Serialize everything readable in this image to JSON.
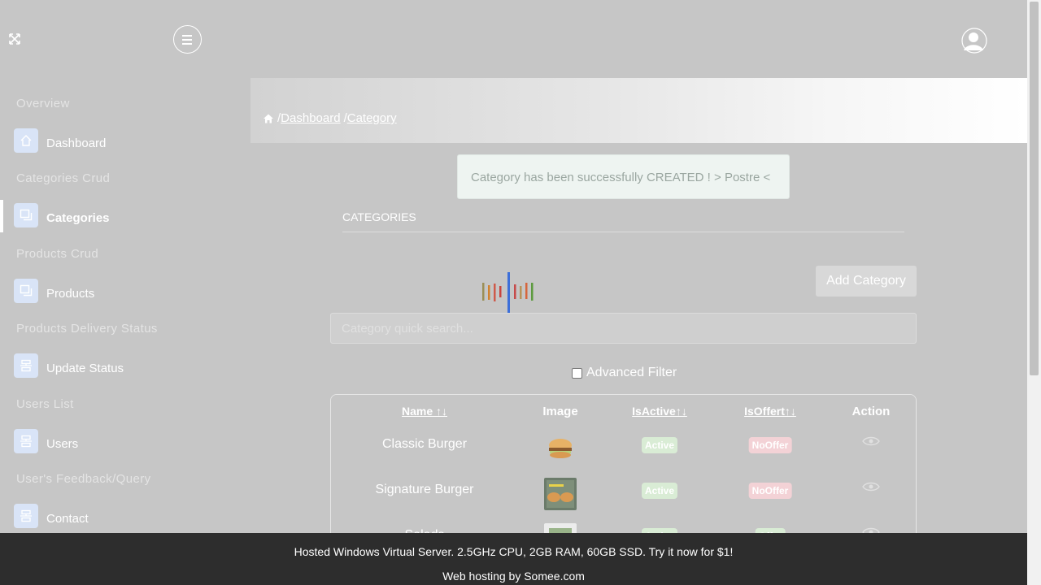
{
  "topbar": {
    "expand_icon": "expand-arrows-icon",
    "menu_icon": "hamburger-menu-icon",
    "avatar_icon": "user-avatar-icon"
  },
  "sidebar": {
    "sections": [
      {
        "title": "Overview",
        "item": {
          "label": "Dashboard",
          "icon": "home-icon"
        }
      },
      {
        "title": "Categories Crud",
        "item": {
          "label": "Categories",
          "icon": "copy-icon",
          "active": true
        }
      },
      {
        "title": "Products Crud",
        "item": {
          "label": "Products",
          "icon": "copy-icon"
        }
      },
      {
        "title": "Products Delivery Status",
        "item": {
          "label": "Update Status",
          "icon": "list-icon"
        }
      },
      {
        "title": "Users List",
        "item": {
          "label": "Users",
          "icon": "list-icon"
        }
      },
      {
        "title": "User's Feedback/Query",
        "item": {
          "label": "Contact",
          "icon": "list-icon"
        }
      }
    ]
  },
  "breadcrumb": {
    "home_icon": "home-icon",
    "sep": "/",
    "items": [
      "Dashboard",
      "Category"
    ]
  },
  "alert": {
    "message": "Category has been successfully CREATED ! > Postre <"
  },
  "main": {
    "heading": "CATEGORIES",
    "add_button": "Add Category",
    "search_placeholder": "Category quick search...",
    "advanced_filter": "Advanced Filter"
  },
  "table": {
    "headers": {
      "name": "Name ↑↓",
      "image": "Image",
      "isactive": "IsActive↑↓",
      "isoffert": "IsOffert↑↓",
      "action": "Action"
    },
    "rows": [
      {
        "name": "Classic Burger",
        "active": "Active",
        "offer": "NoOffer"
      },
      {
        "name": "Signature Burger",
        "active": "Active",
        "offer": "NoOffer"
      },
      {
        "name": "Salads",
        "active": "Active",
        "offer": "Offer"
      }
    ]
  },
  "footer": {
    "ad_text": "Hosted Windows Virtual Server. 2.5GHz CPU, 2GB RAM, 60GB SSD. Try it now for $1!",
    "host_text": "Web hosting by Somee.com"
  },
  "colors": {
    "overlay": "#c6c6c6",
    "alert_bg": "#eef4f1",
    "active_badge": "#d9ecd5",
    "nooffer_badge": "#f3d2d6",
    "footer_bg": "#2d2d2d"
  }
}
